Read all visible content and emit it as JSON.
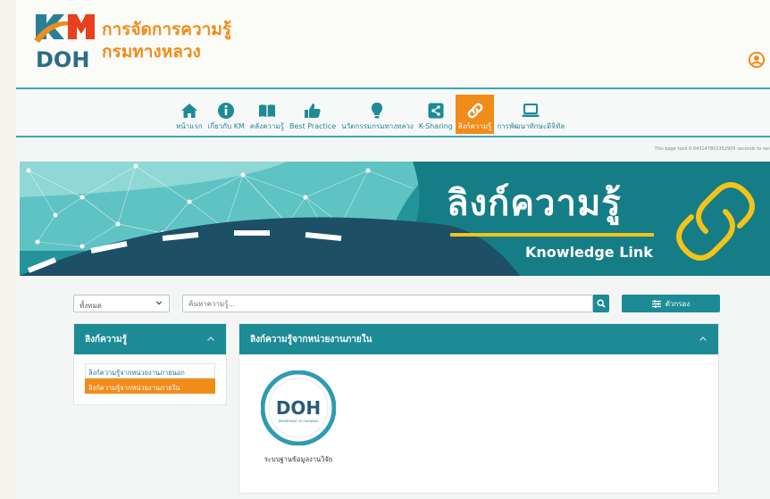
{
  "header": {
    "logo_km": "KM",
    "logo_doh": "DOH",
    "logo_line1": "การจัดการความรู้",
    "logo_line2": "กรมทางหลวง"
  },
  "nav": {
    "items": [
      {
        "label": "หน้าแรก",
        "icon": "home-icon"
      },
      {
        "label": "เกี่ยวกับ KM",
        "icon": "info-icon"
      },
      {
        "label": "คลังความรู้",
        "icon": "book-icon"
      },
      {
        "label": "Best Practice",
        "icon": "thumbs-up-icon"
      },
      {
        "label": "นวัตกรรมกรมทางหลวง",
        "icon": "lightbulb-icon"
      },
      {
        "label": "K-Sharing",
        "icon": "share-icon"
      },
      {
        "label": "ลิงก์ความรู้",
        "icon": "link-icon",
        "active": true
      },
      {
        "label": "การพัฒนาทักษะดิจิทัล",
        "icon": "laptop-icon"
      }
    ],
    "active_color": "#f08c19",
    "text_color": "#2a8592"
  },
  "timing_text": "This page took 0.043147802352905 seconds to ren",
  "banner": {
    "title": "ลิงก์ความรู้",
    "subtitle": "Knowledge Link",
    "accent": "#f5c21a"
  },
  "filter": {
    "select_value": "ทั้งหมด",
    "search_placeholder": "ค้นหาความรู้...",
    "filter_label": "ตัวกรอง"
  },
  "sidebar": {
    "title": "ลิงก์ความรู้",
    "items": [
      {
        "label": "ลิงก์ความรู้จากหน่วยงานภายนอก",
        "active": false
      },
      {
        "label": "ลิงก์ความรู้จากหน่วยงานภายใน",
        "active": true
      }
    ]
  },
  "main": {
    "title": "ลิงก์ความรู้จากหน่วยงานภายใน",
    "cards": [
      {
        "label": "ระบบฐานข้อมูลงานวิจัย",
        "logo_text": "DOH",
        "logo_caption": "DEPARTMENT OF HIGHWAYS"
      }
    ]
  },
  "colors": {
    "teal": "#1c8b96",
    "orange": "#f08c19"
  }
}
